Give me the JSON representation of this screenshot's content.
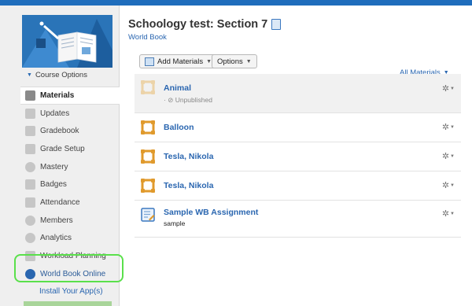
{
  "header": {
    "title": "Schoology test: Section 7",
    "section": "World Book"
  },
  "sidebar": {
    "course_options": "Course Options",
    "items": [
      {
        "label": "Materials",
        "icon": "materials-icon",
        "active": true
      },
      {
        "label": "Updates",
        "icon": "updates-icon"
      },
      {
        "label": "Gradebook",
        "icon": "gradebook-icon"
      },
      {
        "label": "Grade Setup",
        "icon": "grade-setup-icon"
      },
      {
        "label": "Mastery",
        "icon": "mastery-icon"
      },
      {
        "label": "Badges",
        "icon": "badge-icon"
      },
      {
        "label": "Attendance",
        "icon": "attendance-icon"
      },
      {
        "label": "Members",
        "icon": "members-icon"
      },
      {
        "label": "Analytics",
        "icon": "analytics-icon"
      },
      {
        "label": "Workload Planning",
        "icon": "workload-icon"
      },
      {
        "label": "World Book Online",
        "icon": "world-book-icon"
      }
    ],
    "install_link": "Install Your App(s)"
  },
  "toolbar": {
    "add_materials": "Add Materials",
    "options": "Options",
    "all_materials": "All Materials"
  },
  "materials": [
    {
      "title": "Animal",
      "status": "Unpublished",
      "status_prefix": "· ⊘",
      "icon": "folder-icon",
      "published": false
    },
    {
      "title": "Balloon",
      "icon": "folder-icon",
      "published": true
    },
    {
      "title": "Tesla, Nikola",
      "icon": "folder-icon",
      "published": true
    },
    {
      "title": "Tesla, Nikola",
      "icon": "folder-icon",
      "published": true
    },
    {
      "title": "Sample WB Assignment",
      "subtitle": "sample",
      "icon": "assignment-icon",
      "published": true
    }
  ],
  "colors": {
    "brand_blue": "#1f6dbc",
    "link_blue": "#2a66b0",
    "highlight_green": "#5ae04b",
    "folder_orange": "#e09a2c"
  }
}
